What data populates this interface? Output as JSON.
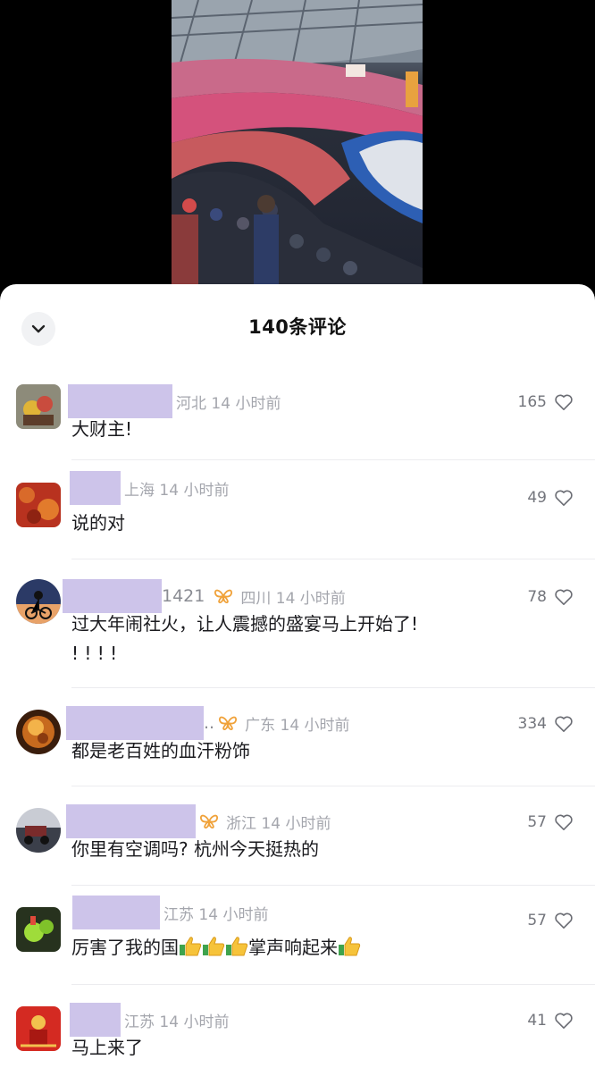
{
  "panel": {
    "title": "140条评论"
  },
  "comments": [
    {
      "suffix": "",
      "location": "河北",
      "time": "14 小时前",
      "likes": "165",
      "text": "大财主!",
      "badge": false
    },
    {
      "suffix": "",
      "location": "上海",
      "time": "14 小时前",
      "likes": "49",
      "text": "说的对",
      "badge": false
    },
    {
      "suffix": "1421",
      "location": "四川",
      "time": "14 小时前",
      "likes": "78",
      "text": "过大年闹社火，让人震撼的盛宴马上开始了!",
      "text2": "! ! ! !",
      "badge": true
    },
    {
      "suffix": "..",
      "location": "广东",
      "time": "14 小时前",
      "likes": "334",
      "text": "都是老百姓的血汗粉饰",
      "badge": true
    },
    {
      "suffix": "",
      "location": "浙江",
      "time": "14 小时前",
      "likes": "57",
      "text": "你里有空调吗? 杭州今天挺热的",
      "badge": true
    },
    {
      "suffix": "",
      "location": "江苏",
      "time": "14 小时前",
      "likes": "57",
      "text_a": "厉害了我的国",
      "text_b": "掌声响起来",
      "badge": false
    },
    {
      "suffix": "",
      "location": "江苏",
      "time": "14 小时前",
      "likes": "41",
      "text": "马上来了",
      "badge": false
    }
  ],
  "icons": {
    "collapse": "chevron-down-icon",
    "like": "heart-outline-icon",
    "badge": "butterfly-badge-icon",
    "emoji": "thumbs-up-emoji"
  },
  "colors": {
    "redaction": "#cdc4ea",
    "badge": "#f0a23a",
    "meta": "#a4a6ad"
  }
}
